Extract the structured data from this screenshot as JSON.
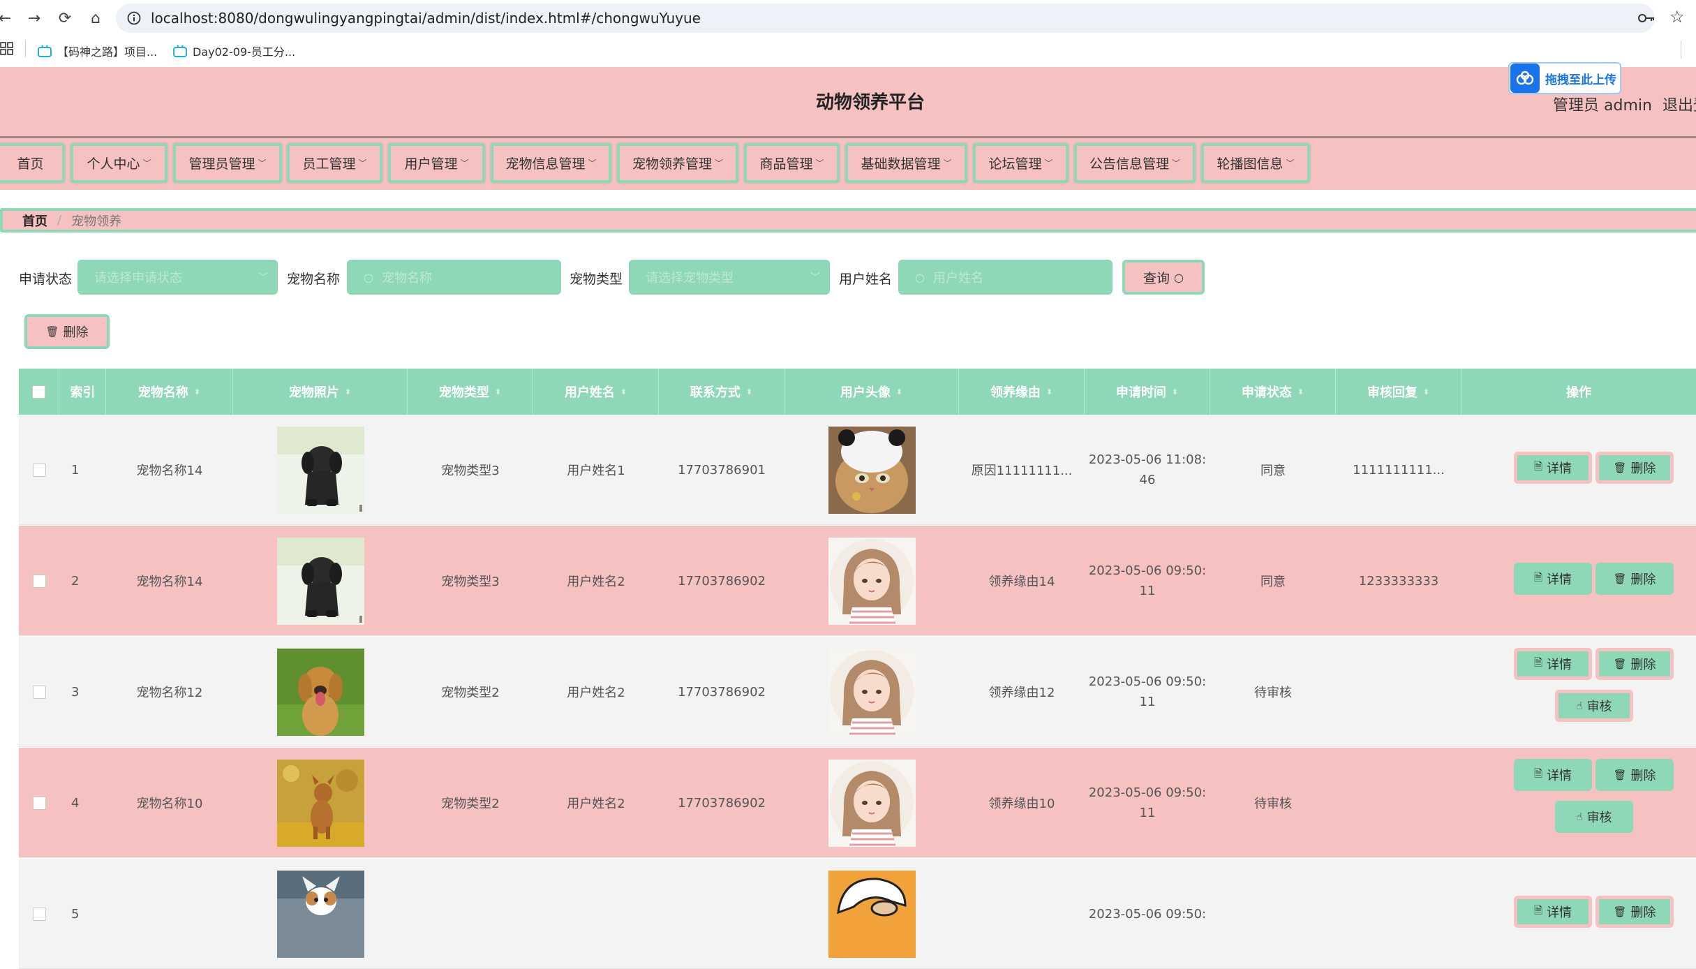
{
  "browser": {
    "url": "localhost:8080/dongwulingyangpingtai/admin/dist/index.html#/chongwuYuyue",
    "bookmarks": [
      "【码神之路】项目...",
      "Day02-09-员工分..."
    ]
  },
  "header": {
    "title": "动物领养平台",
    "admin_label": "管理员 admin",
    "logout_label": "退出登",
    "upload_widget": "拖拽至此上传"
  },
  "menu": [
    "首页",
    "个人中心",
    "管理员管理",
    "员工管理",
    "用户管理",
    "宠物信息管理",
    "宠物领养管理",
    "商品管理",
    "基础数据管理",
    "论坛管理",
    "公告信息管理",
    "轮播图信息"
  ],
  "breadcrumb": {
    "home": "首页",
    "separator": "/",
    "current": "宠物领养"
  },
  "search": {
    "status_label": "申请状态",
    "status_placeholder": "请选择申请状态",
    "pet_name_label": "宠物名称",
    "pet_name_placeholder": "宠物名称",
    "pet_type_label": "宠物类型",
    "pet_type_placeholder": "请选择宠物类型",
    "user_name_label": "用户姓名",
    "user_name_placeholder": "用户姓名",
    "query_button": "查询"
  },
  "toolbar": {
    "delete_button": "删除"
  },
  "table": {
    "columns": [
      "索引",
      "宠物名称",
      "宠物照片",
      "宠物类型",
      "用户姓名",
      "联系方式",
      "用户头像",
      "领养缘由",
      "申请时间",
      "申请状态",
      "审核回复",
      "操作"
    ],
    "rows": [
      {
        "index": "1",
        "pet_name": "宠物名称14",
        "pet_type": "宠物类型3",
        "user_name": "用户姓名1",
        "phone": "17703786901",
        "reason": "原因11111111...",
        "time_line1": "2023-05-06 11:08:",
        "time_line2": "46",
        "status": "同意",
        "reply": "1111111111...",
        "photo": "black-dog-figurine",
        "avatar": "cat-with-panda-hat"
      },
      {
        "index": "2",
        "pet_name": "宠物名称14",
        "pet_type": "宠物类型3",
        "user_name": "用户姓名2",
        "phone": "17703786902",
        "reason": "领养缘由14",
        "time_line1": "2023-05-06 09:50:",
        "time_line2": "11",
        "status": "同意",
        "reply": "1233333333",
        "photo": "black-dog-figurine",
        "avatar": "girl-illustration"
      },
      {
        "index": "3",
        "pet_name": "宠物名称12",
        "pet_type": "宠物类型2",
        "user_name": "用户姓名2",
        "phone": "17703786902",
        "reason": "领养缘由12",
        "time_line1": "2023-05-06 09:50:",
        "time_line2": "11",
        "status": "待审核",
        "reply": "",
        "photo": "golden-retriever",
        "avatar": "girl-illustration"
      },
      {
        "index": "4",
        "pet_name": "宠物名称10",
        "pet_type": "宠物类型2",
        "user_name": "用户姓名2",
        "phone": "17703786902",
        "reason": "领养缘由10",
        "time_line1": "2023-05-06 09:50:",
        "time_line2": "11",
        "status": "待审核",
        "reply": "",
        "photo": "dog-in-autumn-leaves",
        "avatar": "girl-illustration"
      },
      {
        "index": "5",
        "pet_name": "",
        "pet_type": "",
        "user_name": "",
        "phone": "",
        "reason": "",
        "time_line1": "2023-05-06 09:50:",
        "time_line2": "",
        "status": "",
        "reply": "",
        "photo": "corgi",
        "avatar": "cartoon-character"
      }
    ],
    "actions": {
      "detail": "详情",
      "delete": "删除",
      "review": "审核"
    }
  },
  "colors": {
    "pink": "#f6c1c1",
    "mint": "#8ed8b7",
    "row_alt": "#f3f3f3",
    "upload_blue": "#1a73e8"
  }
}
